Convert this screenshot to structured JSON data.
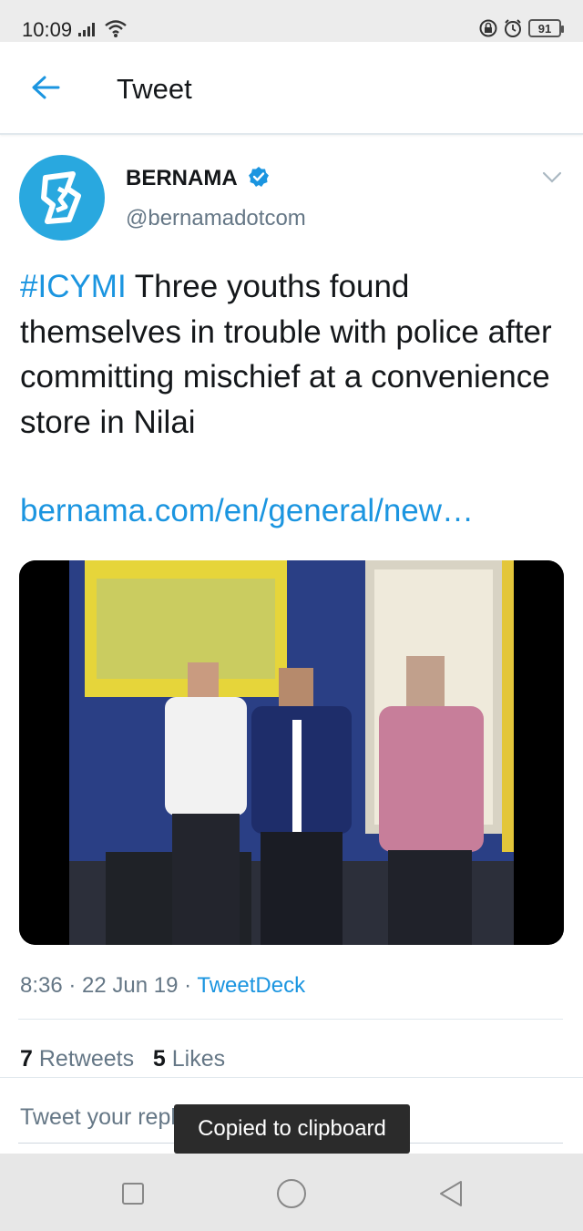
{
  "status_bar": {
    "time": "10:09",
    "battery": "91"
  },
  "header": {
    "title": "Tweet"
  },
  "tweet": {
    "display_name": "BERNAMA",
    "handle": "@bernamadotcom",
    "hashtag": "#ICYMI",
    "text": " Three youths found themselves in trouble with police after committing mischief at a convenience store in Nilai",
    "link": "bernama.com/en/general/new…",
    "time": "8:36",
    "date": "22 Jun 19",
    "source": "TweetDeck",
    "separator": " · ",
    "retweets_count": "7",
    "retweets_label": "Retweets",
    "likes_count": "5",
    "likes_label": "Likes"
  },
  "reply": {
    "placeholder": "Tweet your reply"
  },
  "toast": {
    "text": "Copied to clipboard"
  },
  "colors": {
    "accent": "#1b95e0",
    "avatar_bg": "#29a8df",
    "muted": "#657786"
  },
  "icons": {
    "back": "arrow-left-icon",
    "verified": "verified-badge-icon",
    "more": "chevron-down-icon",
    "nav_recents": "square-icon",
    "nav_home": "circle-icon",
    "nav_back": "triangle-back-icon"
  }
}
